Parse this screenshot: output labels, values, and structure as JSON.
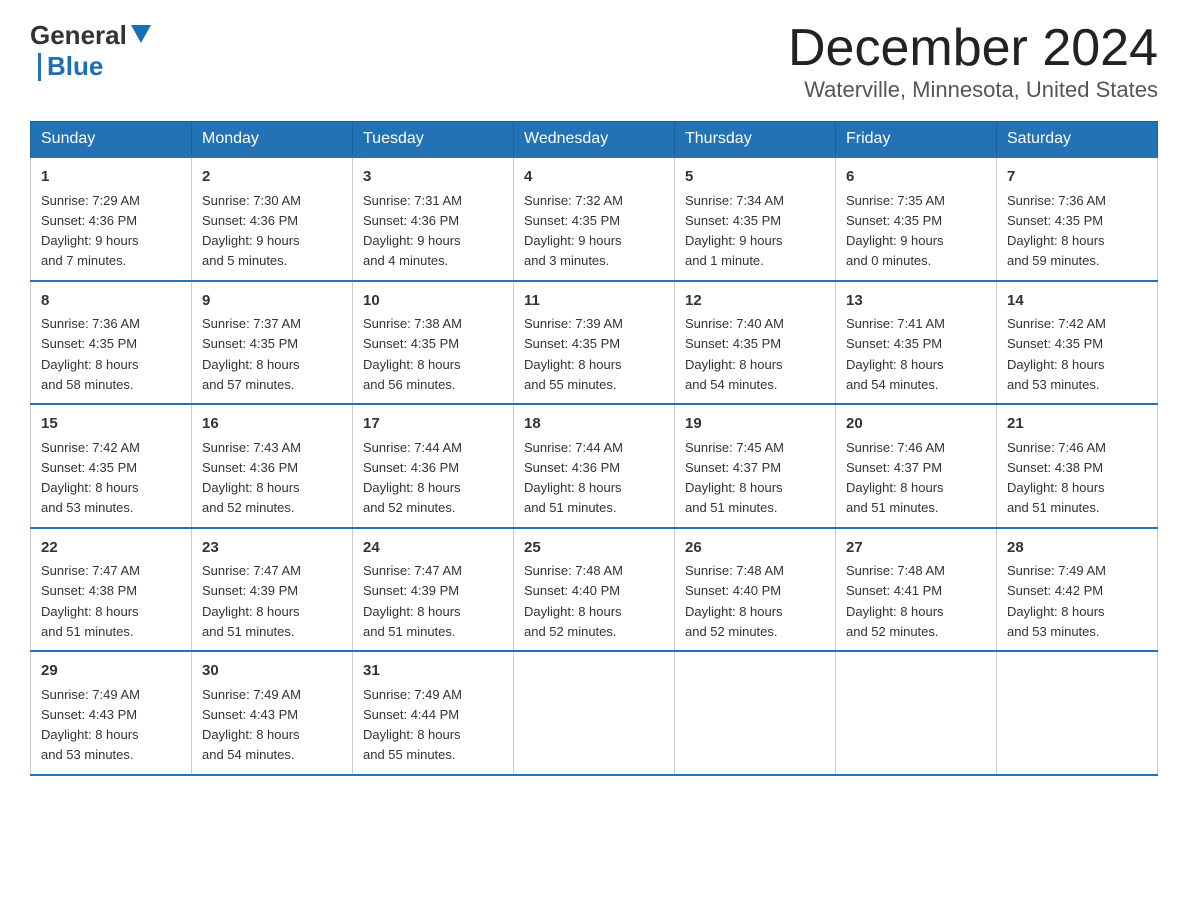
{
  "header": {
    "logo": {
      "general": "General",
      "blue": "Blue"
    },
    "title": "December 2024",
    "location": "Waterville, Minnesota, United States"
  },
  "weekdays": [
    "Sunday",
    "Monday",
    "Tuesday",
    "Wednesday",
    "Thursday",
    "Friday",
    "Saturday"
  ],
  "weeks": [
    [
      {
        "day": "1",
        "sunrise": "7:29 AM",
        "sunset": "4:36 PM",
        "daylight": "9 hours and 7 minutes."
      },
      {
        "day": "2",
        "sunrise": "7:30 AM",
        "sunset": "4:36 PM",
        "daylight": "9 hours and 5 minutes."
      },
      {
        "day": "3",
        "sunrise": "7:31 AM",
        "sunset": "4:36 PM",
        "daylight": "9 hours and 4 minutes."
      },
      {
        "day": "4",
        "sunrise": "7:32 AM",
        "sunset": "4:35 PM",
        "daylight": "9 hours and 3 minutes."
      },
      {
        "day": "5",
        "sunrise": "7:34 AM",
        "sunset": "4:35 PM",
        "daylight": "9 hours and 1 minute."
      },
      {
        "day": "6",
        "sunrise": "7:35 AM",
        "sunset": "4:35 PM",
        "daylight": "9 hours and 0 minutes."
      },
      {
        "day": "7",
        "sunrise": "7:36 AM",
        "sunset": "4:35 PM",
        "daylight": "8 hours and 59 minutes."
      }
    ],
    [
      {
        "day": "8",
        "sunrise": "7:36 AM",
        "sunset": "4:35 PM",
        "daylight": "8 hours and 58 minutes."
      },
      {
        "day": "9",
        "sunrise": "7:37 AM",
        "sunset": "4:35 PM",
        "daylight": "8 hours and 57 minutes."
      },
      {
        "day": "10",
        "sunrise": "7:38 AM",
        "sunset": "4:35 PM",
        "daylight": "8 hours and 56 minutes."
      },
      {
        "day": "11",
        "sunrise": "7:39 AM",
        "sunset": "4:35 PM",
        "daylight": "8 hours and 55 minutes."
      },
      {
        "day": "12",
        "sunrise": "7:40 AM",
        "sunset": "4:35 PM",
        "daylight": "8 hours and 54 minutes."
      },
      {
        "day": "13",
        "sunrise": "7:41 AM",
        "sunset": "4:35 PM",
        "daylight": "8 hours and 54 minutes."
      },
      {
        "day": "14",
        "sunrise": "7:42 AM",
        "sunset": "4:35 PM",
        "daylight": "8 hours and 53 minutes."
      }
    ],
    [
      {
        "day": "15",
        "sunrise": "7:42 AM",
        "sunset": "4:35 PM",
        "daylight": "8 hours and 53 minutes."
      },
      {
        "day": "16",
        "sunrise": "7:43 AM",
        "sunset": "4:36 PM",
        "daylight": "8 hours and 52 minutes."
      },
      {
        "day": "17",
        "sunrise": "7:44 AM",
        "sunset": "4:36 PM",
        "daylight": "8 hours and 52 minutes."
      },
      {
        "day": "18",
        "sunrise": "7:44 AM",
        "sunset": "4:36 PM",
        "daylight": "8 hours and 51 minutes."
      },
      {
        "day": "19",
        "sunrise": "7:45 AM",
        "sunset": "4:37 PM",
        "daylight": "8 hours and 51 minutes."
      },
      {
        "day": "20",
        "sunrise": "7:46 AM",
        "sunset": "4:37 PM",
        "daylight": "8 hours and 51 minutes."
      },
      {
        "day": "21",
        "sunrise": "7:46 AM",
        "sunset": "4:38 PM",
        "daylight": "8 hours and 51 minutes."
      }
    ],
    [
      {
        "day": "22",
        "sunrise": "7:47 AM",
        "sunset": "4:38 PM",
        "daylight": "8 hours and 51 minutes."
      },
      {
        "day": "23",
        "sunrise": "7:47 AM",
        "sunset": "4:39 PM",
        "daylight": "8 hours and 51 minutes."
      },
      {
        "day": "24",
        "sunrise": "7:47 AM",
        "sunset": "4:39 PM",
        "daylight": "8 hours and 51 minutes."
      },
      {
        "day": "25",
        "sunrise": "7:48 AM",
        "sunset": "4:40 PM",
        "daylight": "8 hours and 52 minutes."
      },
      {
        "day": "26",
        "sunrise": "7:48 AM",
        "sunset": "4:40 PM",
        "daylight": "8 hours and 52 minutes."
      },
      {
        "day": "27",
        "sunrise": "7:48 AM",
        "sunset": "4:41 PM",
        "daylight": "8 hours and 52 minutes."
      },
      {
        "day": "28",
        "sunrise": "7:49 AM",
        "sunset": "4:42 PM",
        "daylight": "8 hours and 53 minutes."
      }
    ],
    [
      {
        "day": "29",
        "sunrise": "7:49 AM",
        "sunset": "4:43 PM",
        "daylight": "8 hours and 53 minutes."
      },
      {
        "day": "30",
        "sunrise": "7:49 AM",
        "sunset": "4:43 PM",
        "daylight": "8 hours and 54 minutes."
      },
      {
        "day": "31",
        "sunrise": "7:49 AM",
        "sunset": "4:44 PM",
        "daylight": "8 hours and 55 minutes."
      },
      null,
      null,
      null,
      null
    ]
  ],
  "labels": {
    "sunrise": "Sunrise:",
    "sunset": "Sunset:",
    "daylight": "Daylight:"
  }
}
